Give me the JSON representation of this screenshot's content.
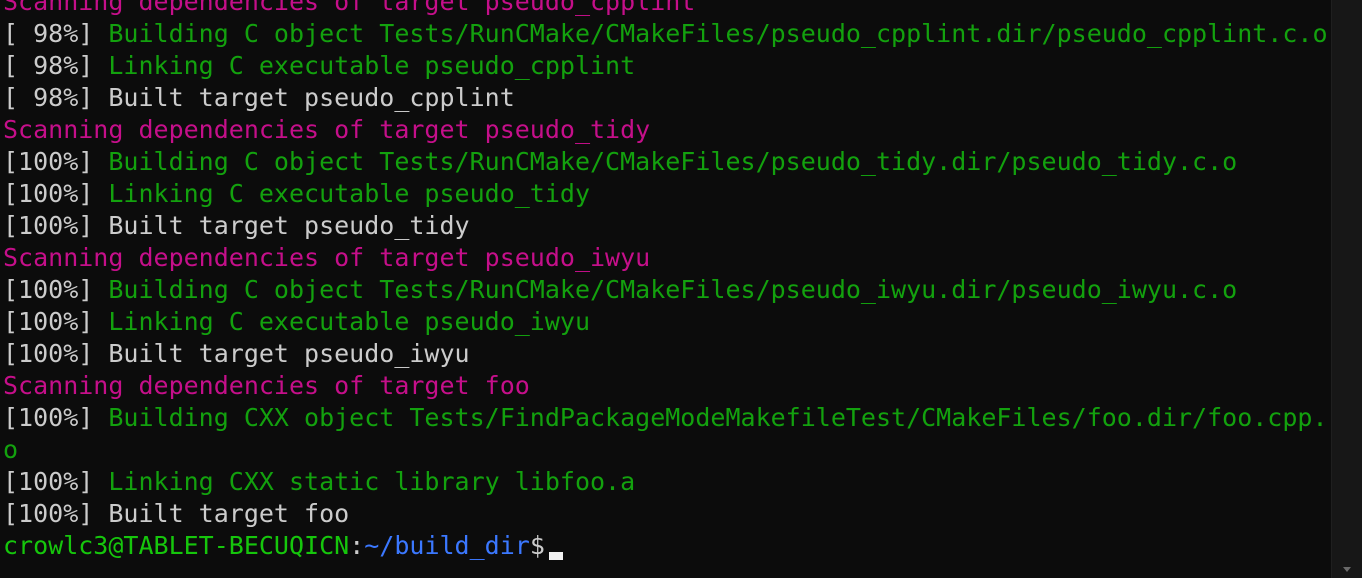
{
  "lines": [
    {
      "type": "scan",
      "text": "Scanning dependencies of target pseudo_cpplint"
    },
    {
      "type": "build",
      "pct": "[ 98%] ",
      "text": "Building C object Tests/RunCMake/CMakeFiles/pseudo_cpplint.dir/pseudo_cpplint.c.o"
    },
    {
      "type": "build",
      "pct": "[ 98%] ",
      "text": "Linking C executable pseudo_cpplint"
    },
    {
      "type": "built",
      "pct": "[ 98%] ",
      "text": "Built target pseudo_cpplint"
    },
    {
      "type": "scan",
      "text": "Scanning dependencies of target pseudo_tidy"
    },
    {
      "type": "build",
      "pct": "[100%] ",
      "text": "Building C object Tests/RunCMake/CMakeFiles/pseudo_tidy.dir/pseudo_tidy.c.o"
    },
    {
      "type": "build",
      "pct": "[100%] ",
      "text": "Linking C executable pseudo_tidy"
    },
    {
      "type": "built",
      "pct": "[100%] ",
      "text": "Built target pseudo_tidy"
    },
    {
      "type": "scan",
      "text": "Scanning dependencies of target pseudo_iwyu"
    },
    {
      "type": "build",
      "pct": "[100%] ",
      "text": "Building C object Tests/RunCMake/CMakeFiles/pseudo_iwyu.dir/pseudo_iwyu.c.o"
    },
    {
      "type": "build",
      "pct": "[100%] ",
      "text": "Linking C executable pseudo_iwyu"
    },
    {
      "type": "built",
      "pct": "[100%] ",
      "text": "Built target pseudo_iwyu"
    },
    {
      "type": "scan",
      "text": "Scanning dependencies of target foo"
    },
    {
      "type": "build",
      "pct": "[100%] ",
      "text": "Building CXX object Tests/FindPackageModeMakefileTest/CMakeFiles/foo.dir/foo.cpp."
    },
    {
      "type": "wrap",
      "text": "o"
    },
    {
      "type": "build",
      "pct": "[100%] ",
      "text": "Linking CXX static library libfoo.a"
    },
    {
      "type": "built",
      "pct": "[100%] ",
      "text": "Built target foo"
    }
  ],
  "prompt": {
    "user_host": "crowlc3@TABLET-BECUQICN",
    "separator": ":",
    "path": "~/build_dir",
    "symbol": "$"
  },
  "colors": {
    "background": "#0c0c0c",
    "green": "#13a10e",
    "magenta": "#c50f8a",
    "white": "#cccccc",
    "prompt_user": "#16c60c",
    "prompt_path": "#3b78ff"
  }
}
